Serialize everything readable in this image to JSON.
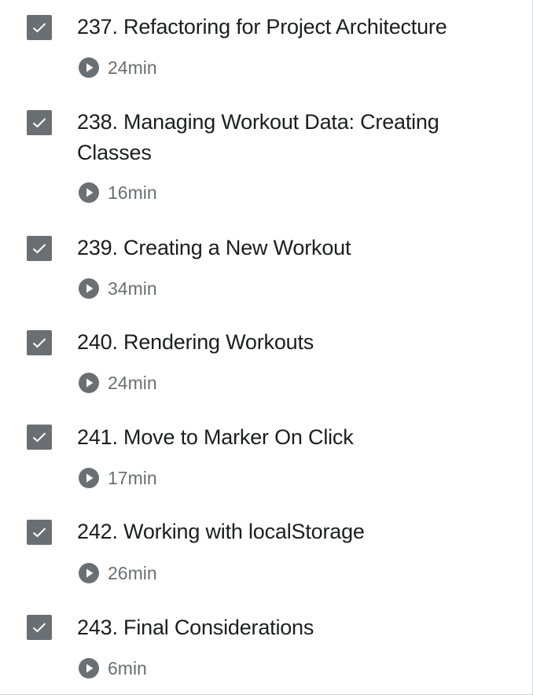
{
  "colors": {
    "checkbox": "#6a6f73",
    "title": "#1c1d1f",
    "meta": "#6a6f73"
  },
  "lectures": [
    {
      "title": "237. Refactoring for Project Architecture",
      "duration": "24min",
      "completed": true,
      "icon": "play-circle"
    },
    {
      "title": "238. Managing Workout Data: Creating Classes",
      "duration": "16min",
      "completed": true,
      "icon": "play-circle"
    },
    {
      "title": "239. Creating a New Workout",
      "duration": "34min",
      "completed": true,
      "icon": "play-circle"
    },
    {
      "title": "240. Rendering Workouts",
      "duration": "24min",
      "completed": true,
      "icon": "play-circle"
    },
    {
      "title": "241. Move to Marker On Click",
      "duration": "17min",
      "completed": true,
      "icon": "play-circle"
    },
    {
      "title": "242. Working with localStorage",
      "duration": "26min",
      "completed": true,
      "icon": "play-circle"
    },
    {
      "title": "243. Final Considerations",
      "duration": "6min",
      "completed": true,
      "icon": "play-circle"
    }
  ]
}
